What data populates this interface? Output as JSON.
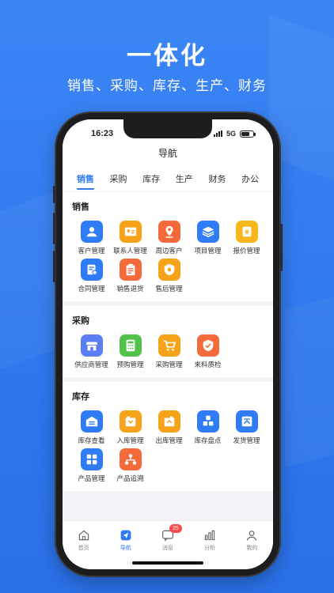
{
  "promo": {
    "title": "一体化",
    "subtitle": "销售、采购、库存、生产、财务"
  },
  "status": {
    "time": "16:23",
    "network": "5G"
  },
  "nav": {
    "title": "导航"
  },
  "tabs": [
    {
      "label": "销售",
      "active": true
    },
    {
      "label": "采购",
      "active": false
    },
    {
      "label": "库存",
      "active": false
    },
    {
      "label": "生产",
      "active": false
    },
    {
      "label": "财务",
      "active": false
    },
    {
      "label": "办公",
      "active": false
    }
  ],
  "sections": [
    {
      "title": "销售",
      "items": [
        {
          "label": "客户管理",
          "icon": "person-icon",
          "color": "#2f7cf6"
        },
        {
          "label": "联系人管理",
          "icon": "contact-card-icon",
          "color": "#f7a21b"
        },
        {
          "label": "周边客户",
          "icon": "location-pin-icon",
          "color": "#f46a3b"
        },
        {
          "label": "项目管理",
          "icon": "layers-icon",
          "color": "#2f7cf6"
        },
        {
          "label": "报价管理",
          "icon": "price-tag-icon",
          "color": "#f7b71b"
        },
        {
          "label": "合同管理",
          "icon": "contract-icon",
          "color": "#2f7cf6"
        },
        {
          "label": "销售退货",
          "icon": "clipboard-return-icon",
          "color": "#f46a3b"
        },
        {
          "label": "售后管理",
          "icon": "shield-icon",
          "color": "#f7a21b"
        }
      ]
    },
    {
      "title": "采购",
      "items": [
        {
          "label": "供应商管理",
          "icon": "store-icon",
          "color": "#5b7ef5"
        },
        {
          "label": "预购管理",
          "icon": "calculator-icon",
          "color": "#52c24a"
        },
        {
          "label": "采购管理",
          "icon": "cart-icon",
          "color": "#f7a21b"
        },
        {
          "label": "来料质检",
          "icon": "check-shield-icon",
          "color": "#f46a3b"
        }
      ]
    },
    {
      "title": "库存",
      "items": [
        {
          "label": "库存查看",
          "icon": "warehouse-icon",
          "color": "#2f7cf6"
        },
        {
          "label": "入库管理",
          "icon": "inbound-icon",
          "color": "#f7a21b"
        },
        {
          "label": "出库管理",
          "icon": "outbound-icon",
          "color": "#f7a21b"
        },
        {
          "label": "库存盘点",
          "icon": "boxes-icon",
          "color": "#2f7cf6"
        },
        {
          "label": "发货管理",
          "icon": "shipping-icon",
          "color": "#2f7cf6"
        },
        {
          "label": "产品管理",
          "icon": "grid-icon",
          "color": "#2f7cf6"
        },
        {
          "label": "产品追溯",
          "icon": "trace-icon",
          "color": "#f46a3b"
        }
      ]
    }
  ],
  "bottom_tabs": [
    {
      "label": "首页",
      "icon": "home-icon",
      "active": false
    },
    {
      "label": "导航",
      "icon": "navigation-icon",
      "active": true
    },
    {
      "label": "消息",
      "icon": "message-icon",
      "active": false,
      "badge": "25"
    },
    {
      "label": "分析",
      "icon": "bar-chart-icon",
      "active": false
    },
    {
      "label": "我的",
      "icon": "profile-icon",
      "active": false
    }
  ]
}
